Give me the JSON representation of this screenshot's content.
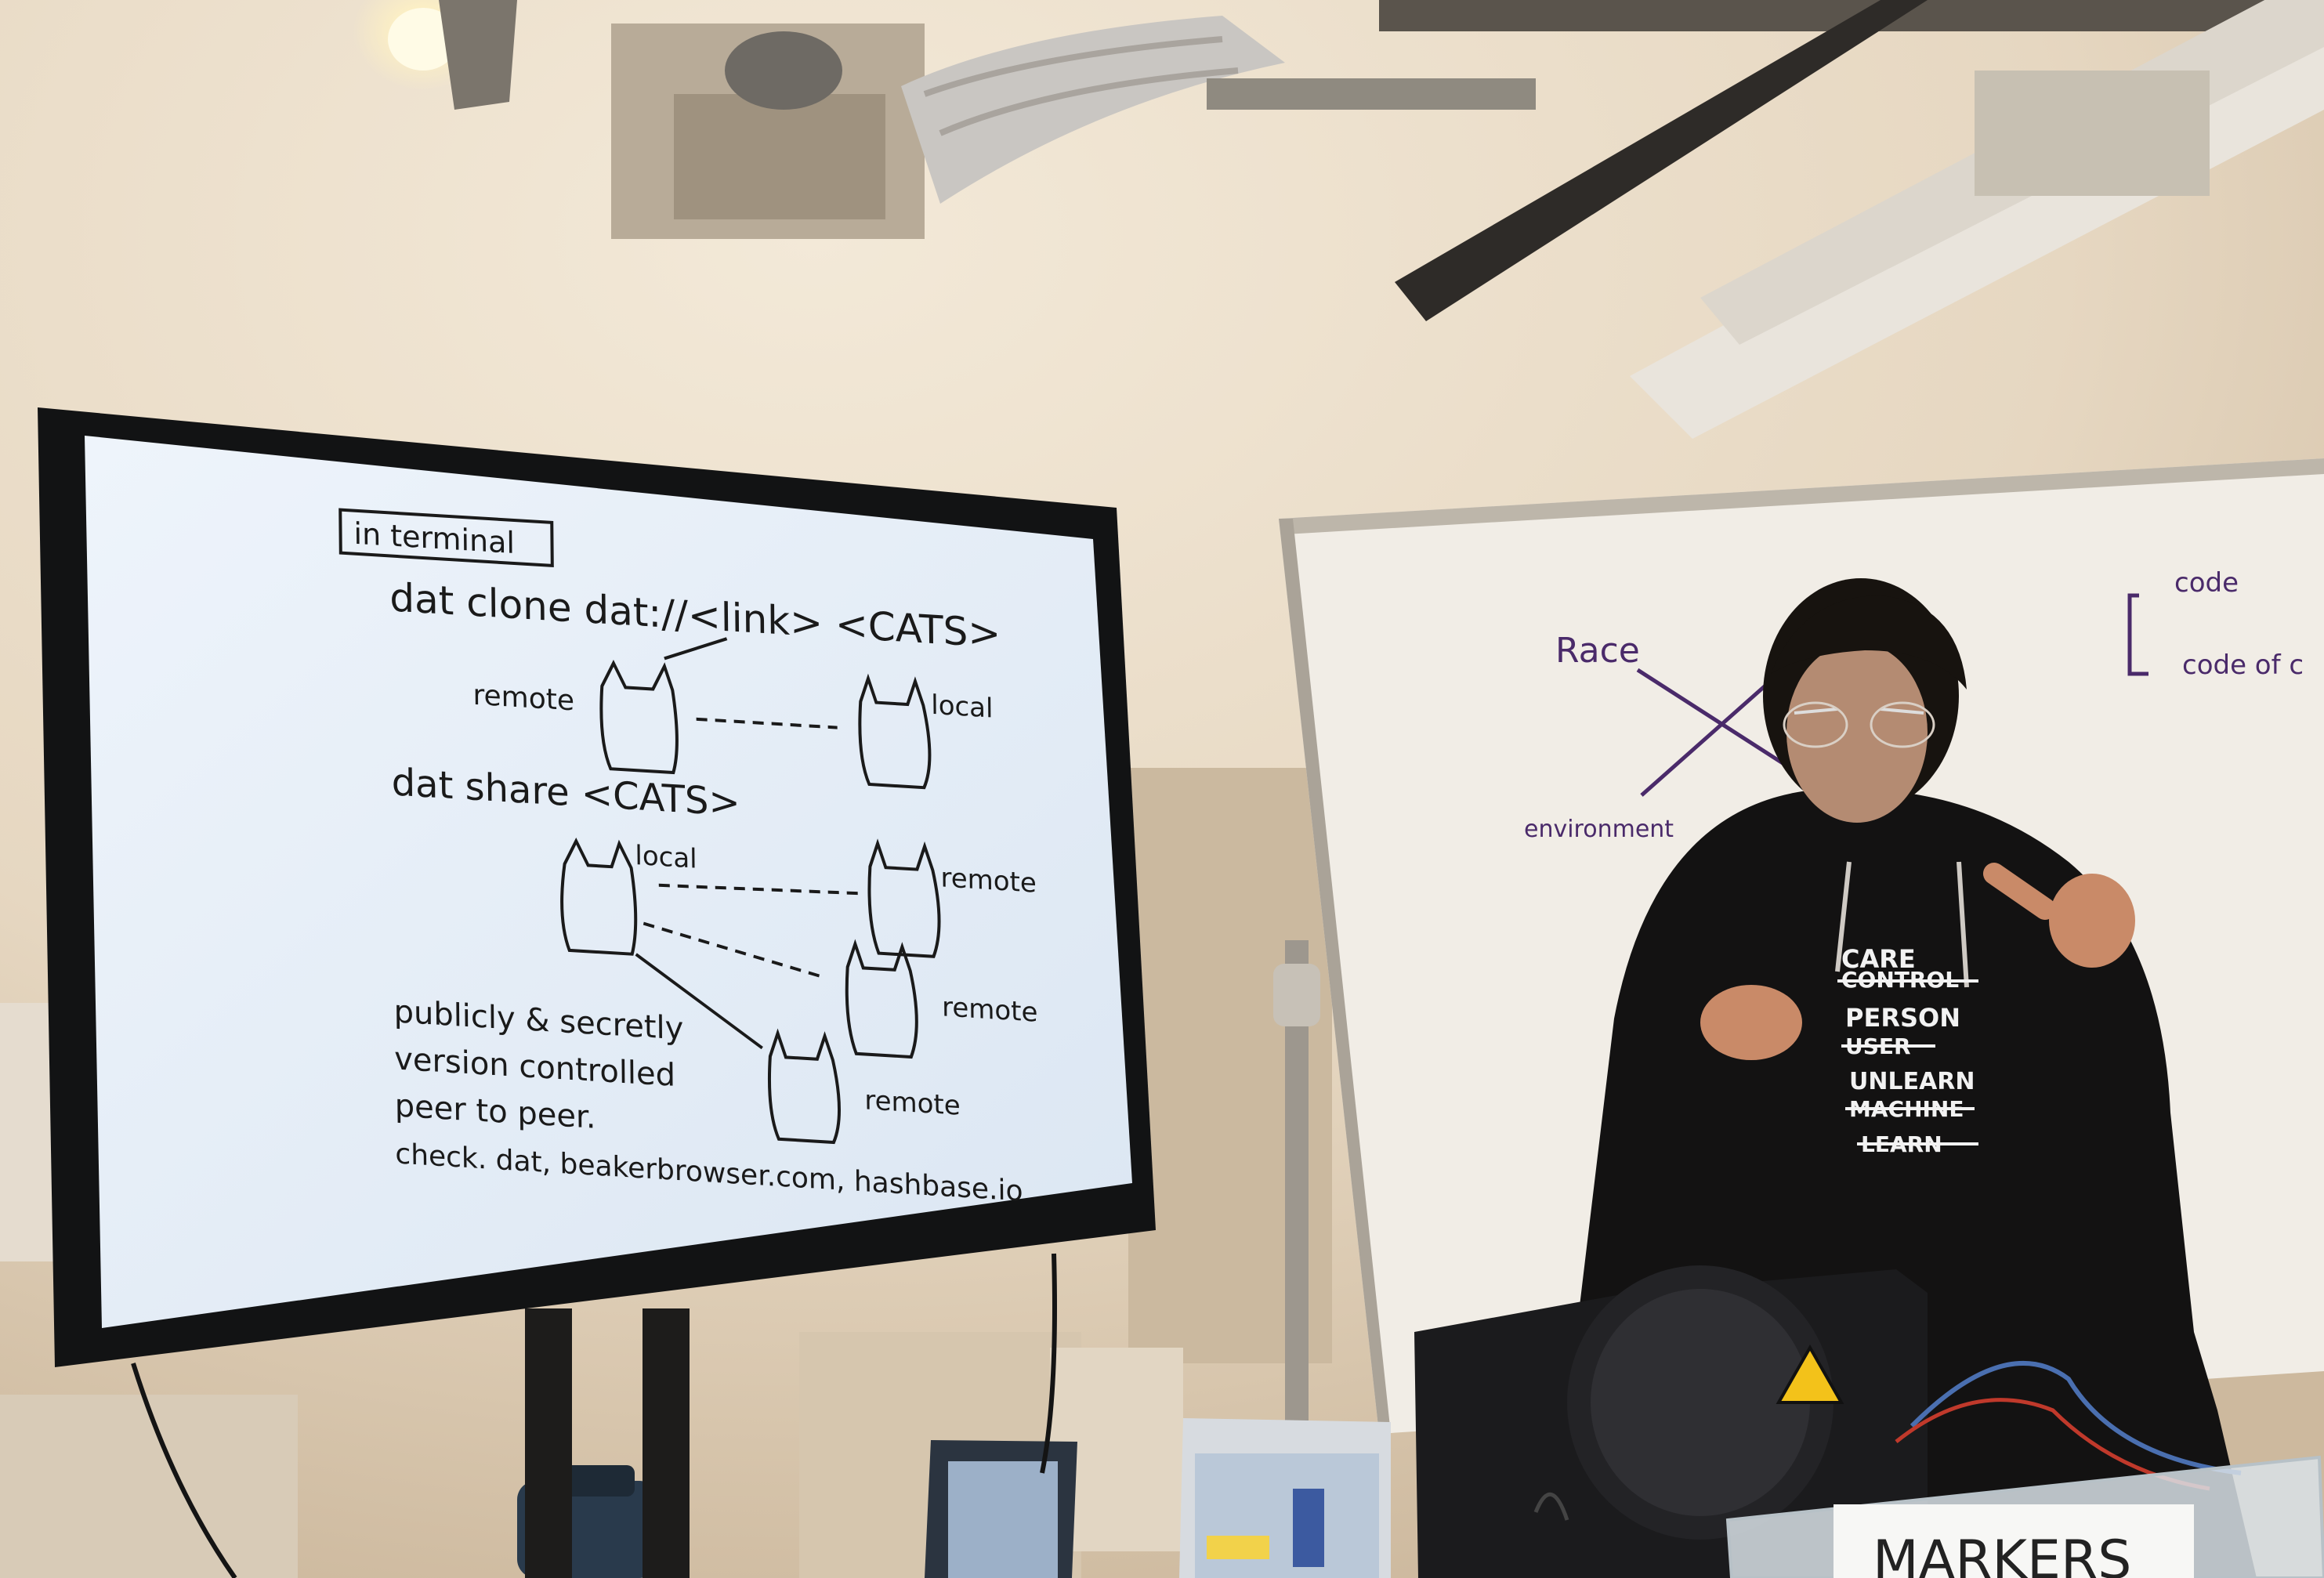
{
  "screen": {
    "boxed_label": "in terminal",
    "line_clone": "dat clone dat://<link> <CATS>",
    "label_remote_1": "remote",
    "label_local_1": "local",
    "line_share": "dat share <CATS>",
    "label_local_2": "local",
    "label_remote_2": "remote",
    "label_remote_3": "remote",
    "label_remote_4": "remote",
    "bullet_1": "publicly & secretly",
    "bullet_2": "version controlled",
    "bullet_3": "peer to peer.",
    "bullet_4": "check. dat, beakerbrowser.com, hashbase.io"
  },
  "whiteboard": {
    "race": "Race",
    "environment": "environment",
    "code": "code",
    "code_of": "code of c"
  },
  "shirt": {
    "lines": [
      "CARE",
      "CONTROL",
      "PERSON",
      "USER",
      "UNLEARN",
      "MACHINE",
      "LEARN"
    ]
  },
  "box_label": "MARKERS"
}
